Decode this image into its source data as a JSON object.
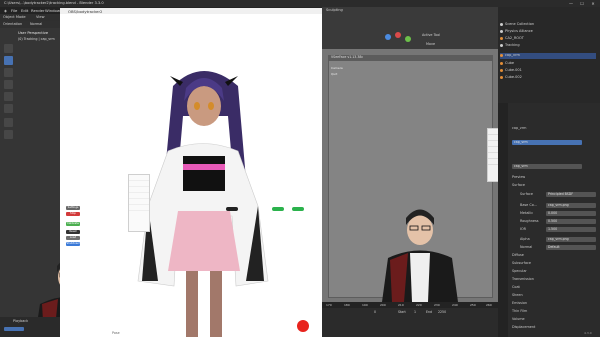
{
  "titlebar": {
    "title": "C:\\Users\\...\\bodytracker2\\tracking.blend - Blender 3.3.0",
    "minimize": "—",
    "maximize": "☐",
    "close": "✕"
  },
  "menubar": {
    "items": [
      "File",
      "Edit",
      "Render",
      "Window",
      "Help",
      "Layout",
      "Modeling",
      "Sculpting",
      "UV Editing",
      "Texture Paint",
      "Shading"
    ],
    "scene_label": "Scene",
    "view_layer": "ViewLayer"
  },
  "left_panel": {
    "mode": "Object Mode",
    "view": "View",
    "orientation": "Orientation",
    "orientation_value": "Normal",
    "viewport_title": "User Perspective",
    "viewport_sub": "(0) Tracking | cap_vrm",
    "playback": "Playback"
  },
  "center": {
    "window_title": "OBS/bodytracker2",
    "footer_label": "Pose",
    "menu_items": [
      "",
      "",
      "",
      "",
      "",
      "",
      "",
      ""
    ],
    "side_buttons": [
      "Settings",
      "Stop Calibrate",
      "Calibrate",
      "Reset",
      "Load",
      "Shutdown"
    ],
    "side_button_colors": [
      "#666666",
      "#d23a3a",
      "#4caf50",
      "#333333",
      "#6e6e6e",
      "#3b7ad8"
    ],
    "pill_labels": [
      "",
      "",
      ""
    ]
  },
  "gray_view": {
    "header_labels": [
      "Active Tool",
      "Move"
    ],
    "subwindow_title": "VSeeFace v1.13.38c",
    "subwindow_text": [
      "Camera",
      "Quit",
      "Detected: 1 face"
    ],
    "menu_list": [
      "",
      "",
      "",
      "",
      "",
      "",
      "",
      ""
    ]
  },
  "timeline": {
    "frame_numbers": [
      "170",
      "180",
      "190",
      "200",
      "210",
      "220",
      "230",
      "240",
      "250",
      "260"
    ],
    "start_label": "Start",
    "start_value": "1",
    "end_label": "End",
    "end_value": "2250",
    "current": "0"
  },
  "outliner": {
    "items": [
      {
        "label": "Scene Collection",
        "selected": false
      },
      {
        "label": "Physics Alliance",
        "selected": false
      },
      {
        "label": "CA2_ROOT",
        "selected": false
      },
      {
        "label": "Tracking",
        "selected": false
      },
      {
        "label": "cap_vrm",
        "selected": true
      },
      {
        "label": "Cube",
        "selected": false
      },
      {
        "label": "Cube.001",
        "selected": false
      },
      {
        "label": "Cube.002",
        "selected": false
      }
    ]
  },
  "properties": {
    "material_slot": "cap_vrm",
    "material_name": "cap_vrm",
    "section_preview": "Preview",
    "section_surface": "Surface",
    "surface_label": "Surface",
    "surface_value": "Principled BSDF",
    "rows": [
      {
        "label": "Base Co...",
        "value": "cap_vrm.png"
      },
      {
        "label": "Metallic",
        "value": "0.000"
      },
      {
        "label": "Roughness",
        "value": "0.500"
      },
      {
        "label": "IOR",
        "value": "1.500"
      },
      {
        "label": "Alpha",
        "value": "cap_vrm.png"
      },
      {
        "label": "Normal",
        "value": "Default"
      }
    ],
    "subsections": [
      "Diffuse",
      "Subsurface",
      "Specular",
      "Transmission",
      "Coat",
      "Sheen",
      "Emission",
      "Thin Film",
      "Volume",
      "Displacement"
    ],
    "version": "4.3.0"
  },
  "colors": {
    "accent": "#4772b3",
    "record": "#e8231d",
    "outliner_selected": "#334d80"
  }
}
